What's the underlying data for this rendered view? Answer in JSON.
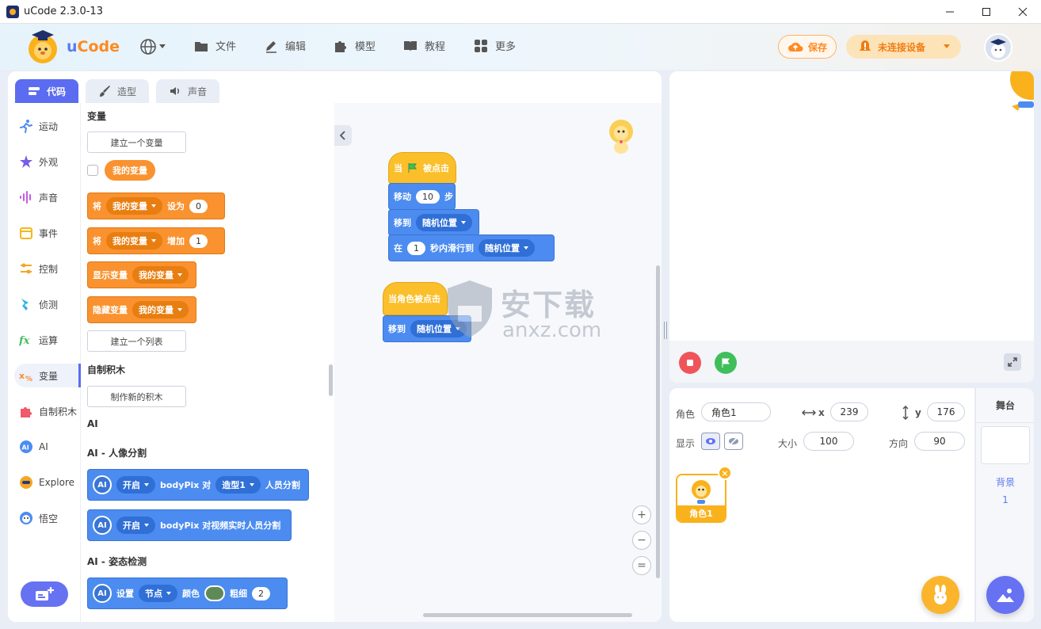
{
  "window": {
    "title": "uCode 2.3.0-13"
  },
  "header": {
    "logo_u": "u",
    "logo_code": "Code",
    "menu": [
      {
        "label": "文件",
        "icon": "folder-icon"
      },
      {
        "label": "编辑",
        "icon": "edit-icon"
      },
      {
        "label": "模型",
        "icon": "puzzle-icon"
      },
      {
        "label": "教程",
        "icon": "book-icon"
      },
      {
        "label": "更多",
        "icon": "grid-icon"
      }
    ],
    "save_label": "保存",
    "device_label": "未连接设备"
  },
  "tabs": [
    {
      "label": "代码",
      "active": true
    },
    {
      "label": "造型",
      "active": false
    },
    {
      "label": "声音",
      "active": false
    }
  ],
  "categories": [
    {
      "label": "运动",
      "icon": "motion-icon",
      "color": "#4c8cf0"
    },
    {
      "label": "外观",
      "icon": "looks-icon",
      "color": "#7a5ce6"
    },
    {
      "label": "声音",
      "icon": "sound-icon",
      "color": "#c65ce6"
    },
    {
      "label": "事件",
      "icon": "event-icon",
      "color": "#f5b71c"
    },
    {
      "label": "控制",
      "icon": "control-icon",
      "color": "#f5a623"
    },
    {
      "label": "侦测",
      "icon": "sensing-icon",
      "color": "#2fb3e8"
    },
    {
      "label": "运算",
      "icon": "operator-icon",
      "color": "#3fbf5a"
    },
    {
      "label": "变量",
      "icon": "variable-icon",
      "color": "#f98a2f",
      "active": true
    },
    {
      "label": "自制积木",
      "icon": "myblock-icon",
      "color": "#f05a6a"
    },
    {
      "label": "AI",
      "icon": "ai-icon",
      "color": "#4c8cf0"
    },
    {
      "label": "Explore",
      "icon": "explore-icon",
      "color": "#f5a623"
    },
    {
      "label": "悟空",
      "icon": "wukong-icon",
      "color": "#4c8cf0"
    }
  ],
  "palette": {
    "variables_title": "变量",
    "make_variable": "建立一个变量",
    "my_variable": "我的变量",
    "set_block": {
      "prefix": "将",
      "var": "我的变量",
      "mid": "设为",
      "value": "0"
    },
    "change_block": {
      "prefix": "将",
      "var": "我的变量",
      "mid": "增加",
      "value": "1"
    },
    "show_block": {
      "prefix": "显示变量",
      "var": "我的变量"
    },
    "hide_block": {
      "prefix": "隐藏变量",
      "var": "我的变量"
    },
    "make_list": "建立一个列表",
    "myblocks_title": "自制积木",
    "make_block": "制作新的积木",
    "ai_title": "AI",
    "ai_seg_title": "AI - 人像分割",
    "seg_block1": {
      "toggle": "开启",
      "text1": "bodyPix 对",
      "costume": "造型1",
      "text2": "人员分割"
    },
    "seg_block2": {
      "toggle": "开启",
      "text": "bodyPix 对视频实时人员分割"
    },
    "ai_pose_title": "AI - 姿态检测",
    "pose_block": {
      "prefix": "设置",
      "node": "节点",
      "color_label": "颜色",
      "width_label": "粗细",
      "width": "2"
    }
  },
  "script": {
    "hat1": {
      "text_a": "当",
      "text_b": "被点击"
    },
    "move": {
      "text_a": "移动",
      "value": "10",
      "text_b": "步"
    },
    "goto": {
      "text": "移到",
      "target": "随机位置"
    },
    "glide": {
      "text_a": "在",
      "value": "1",
      "text_b": "秒内滑行到",
      "target": "随机位置"
    },
    "hat2": {
      "text": "当角色被点击"
    },
    "goto2": {
      "text": "移到",
      "target": "随机位置"
    }
  },
  "watermark": {
    "cn": "安下载",
    "url": "anxz.com"
  },
  "sprite": {
    "label_sprite": "角色",
    "name": "角色1",
    "label_x": "x",
    "x": "239",
    "label_y": "y",
    "y": "176",
    "label_show": "显示",
    "label_size": "大小",
    "size": "100",
    "label_dir": "方向",
    "direction": "90",
    "card_name": "角色1"
  },
  "stage_col": {
    "title": "舞台",
    "backdrop_label": "背景",
    "backdrop_count": "1"
  },
  "colors": {
    "accent": "#5b6cf0",
    "variable": "#f9922f",
    "motion": "#4c8cf0",
    "event": "#fbbf2b"
  }
}
